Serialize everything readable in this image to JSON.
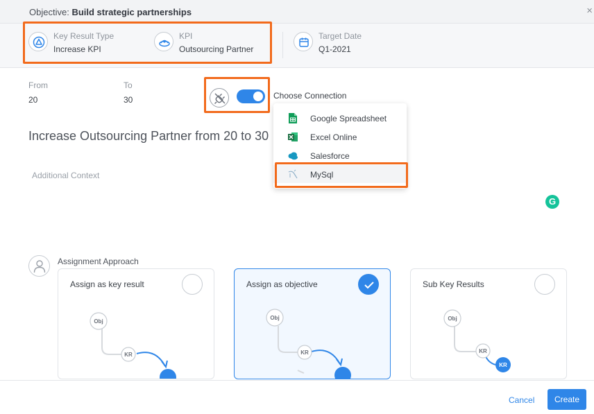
{
  "header": {
    "objective_prefix": "Objective:",
    "objective_name": "Build strategic partnerships",
    "close_glyph": "×"
  },
  "meta": {
    "key_result_type": {
      "label": "Key Result Type",
      "value": "Increase KPI",
      "icon": "triangle-circle-icon"
    },
    "kpi": {
      "label": "KPI",
      "value": "Outsourcing Partner",
      "icon": "kpi-icon"
    },
    "target_date": {
      "label": "Target Date",
      "value": "Q1-2021",
      "icon": "calendar-icon"
    }
  },
  "range": {
    "from_label": "From",
    "from_value": "20",
    "to_label": "To",
    "to_value": "30"
  },
  "connection": {
    "label": "Choose Connection",
    "toggle_on": true,
    "options": [
      {
        "label": "Google Spreadsheet",
        "icon": "google-sheets-icon",
        "color": "#0f9d58"
      },
      {
        "label": "Excel Online",
        "icon": "excel-icon",
        "color": "#1e7145"
      },
      {
        "label": "Salesforce",
        "icon": "salesforce-icon",
        "color": "#1798c1"
      },
      {
        "label": "MySql",
        "icon": "mysql-icon",
        "color": "#4479a1"
      }
    ],
    "selected": "MySql"
  },
  "headline": "Increase Outsourcing Partner from 20 to 30",
  "additional_context_placeholder": "Additional Context",
  "assignment": {
    "label": "Assignment Approach",
    "cards": [
      {
        "title": "Assign as key result",
        "checked": false
      },
      {
        "title": "Assign as objective",
        "checked": true
      },
      {
        "title": "Sub Key Results",
        "checked": false
      }
    ],
    "node_obj": "Obj",
    "node_kr": "KR"
  },
  "footer": {
    "cancel_label": "Cancel",
    "create_label": "Create"
  },
  "colors": {
    "accent": "#2f86e8",
    "highlight": "#f26a1b",
    "grammarly": "#15c39a"
  }
}
